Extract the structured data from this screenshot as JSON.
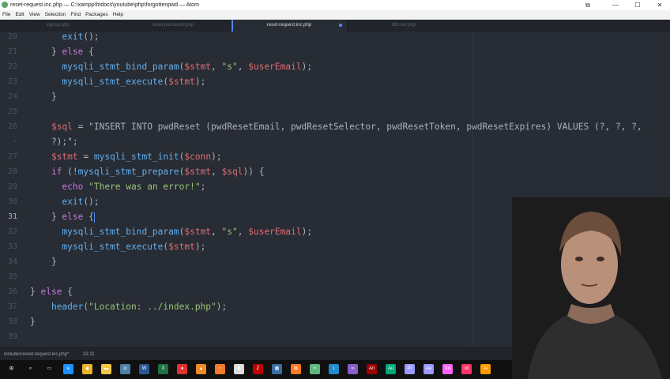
{
  "window": {
    "title": "reset-request.inc.php — C:\\xampp\\htdocs\\youtube\\php\\forgottenpwd — Atom",
    "controls": {
      "minimize": "—",
      "maximize": "☐",
      "close": "✕"
    }
  },
  "menu": [
    "File",
    "Edit",
    "View",
    "Selection",
    "Find",
    "Packages",
    "Help"
  ],
  "tabs": [
    {
      "label": "signup.php",
      "active": false
    },
    {
      "label": "reset-password.php",
      "active": false
    },
    {
      "label": "reset-request.inc.php",
      "active": true,
      "modified": true
    },
    {
      "label": "dbh.inc.php",
      "active": false
    }
  ],
  "editor": {
    "current_line": 31,
    "lines": [
      {
        "n": "20",
        "code": "      exit();"
      },
      {
        "n": "21",
        "code": "    } else {"
      },
      {
        "n": "22",
        "code": "      mysqli_stmt_bind_param($stmt, \"s\", $userEmail);"
      },
      {
        "n": "23",
        "code": "      mysqli_stmt_execute($stmt);"
      },
      {
        "n": "24",
        "code": "    }"
      },
      {
        "n": "25",
        "code": ""
      },
      {
        "n": "26",
        "code": "    $sql = \"INSERT INTO pwdReset (pwdResetEmail, pwdResetSelector, pwdResetToken, pwdResetExpires) VALUES (?, ?, ?,"
      },
      {
        "n": "·",
        "code": "    ?);\";"
      },
      {
        "n": "27",
        "code": "    $stmt = mysqli_stmt_init($conn);"
      },
      {
        "n": "28",
        "code": "    if (!mysqli_stmt_prepare($stmt, $sql)) {"
      },
      {
        "n": "29",
        "code": "      echo \"There was an error!\";"
      },
      {
        "n": "30",
        "code": "      exit();"
      },
      {
        "n": "31",
        "code": "    } else {"
      },
      {
        "n": "32",
        "code": "      mysqli_stmt_bind_param($stmt, \"s\", $userEmail);"
      },
      {
        "n": "33",
        "code": "      mysqli_stmt_execute($stmt);"
      },
      {
        "n": "34",
        "code": "    }"
      },
      {
        "n": "35",
        "code": ""
      },
      {
        "n": "36",
        "code": "} else {"
      },
      {
        "n": "37",
        "code": "    header(\"Location: ../index.php\");"
      },
      {
        "n": "38",
        "code": "}"
      },
      {
        "n": "39",
        "code": ""
      }
    ]
  },
  "status": {
    "file_path": "includes\\reset-request.inc.php*",
    "cursor_position": "31:11"
  },
  "taskbar": {
    "icons": [
      {
        "name": "windows-start-icon",
        "glyph": "⊞",
        "color": "#ffffff"
      },
      {
        "name": "search-icon",
        "glyph": "⌕",
        "color": "#ffffff"
      },
      {
        "name": "task-view-icon",
        "glyph": "▭",
        "color": "#ffffff"
      },
      {
        "name": "edge-icon",
        "glyph": "e",
        "color": "#1e90ff"
      },
      {
        "name": "chrome-icon",
        "glyph": "◉",
        "color": "#e8b32a"
      },
      {
        "name": "file-explorer-icon",
        "glyph": "▬",
        "color": "#f2c744"
      },
      {
        "name": "steam-icon",
        "glyph": "◎",
        "color": "#4a7fa8"
      },
      {
        "name": "word-icon",
        "glyph": "W",
        "color": "#2b5797"
      },
      {
        "name": "excel-icon",
        "glyph": "X",
        "color": "#1e7145"
      },
      {
        "name": "record-icon",
        "glyph": "●",
        "color": "#d33"
      },
      {
        "name": "vlc-icon",
        "glyph": "▲",
        "color": "#f08a24"
      },
      {
        "name": "blender-icon",
        "glyph": "◔",
        "color": "#f5792a"
      },
      {
        "name": "unity-icon",
        "glyph": "◆",
        "color": "#dddddd"
      },
      {
        "name": "filezilla-icon",
        "glyph": "Z",
        "color": "#bf0000"
      },
      {
        "name": "photos-icon",
        "glyph": "▦",
        "color": "#3a6ea5"
      },
      {
        "name": "xampp-icon",
        "glyph": "⊠",
        "color": "#fb7a24"
      },
      {
        "name": "atom-icon",
        "glyph": "⚛",
        "color": "#5fb57d"
      },
      {
        "name": "vscode-icon",
        "glyph": "⟩",
        "color": "#2489ca"
      },
      {
        "name": "visual-studio-icon",
        "glyph": "∞",
        "color": "#865fc5"
      },
      {
        "name": "animate-icon",
        "glyph": "An",
        "color": "#9a0000"
      },
      {
        "name": "audition-icon",
        "glyph": "Au",
        "color": "#00a878"
      },
      {
        "name": "premiere-icon",
        "glyph": "Pr",
        "color": "#9999ff"
      },
      {
        "name": "after-effects-icon",
        "glyph": "Ae",
        "color": "#9999ff"
      },
      {
        "name": "xd-icon",
        "glyph": "Xd",
        "color": "#ff61f6"
      },
      {
        "name": "indesign-icon",
        "glyph": "Id",
        "color": "#ff3366"
      },
      {
        "name": "illustrator-icon",
        "glyph": "Ai",
        "color": "#ff9a00"
      }
    ]
  },
  "colors": {
    "editor_bg": "#282c34",
    "keyword": "#c678dd",
    "variable": "#e06c75",
    "string": "#98c379",
    "text": "#abb2bf",
    "accent": "#568af2"
  }
}
